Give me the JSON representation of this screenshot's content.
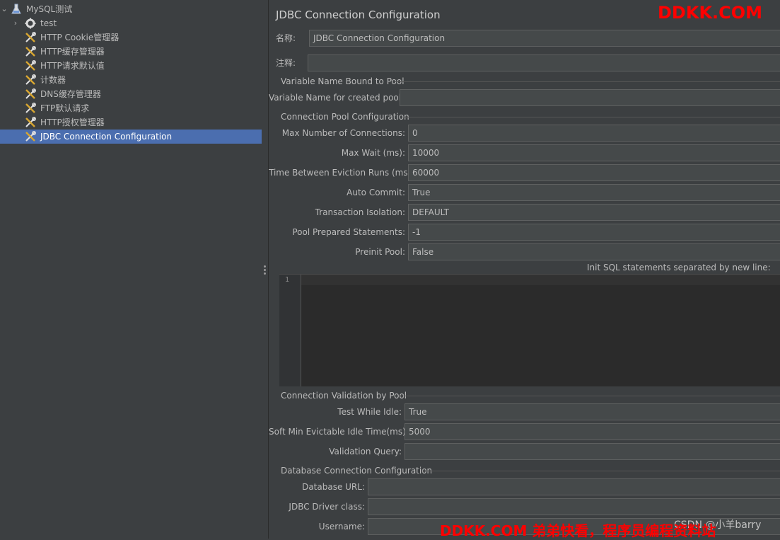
{
  "tree": {
    "root": {
      "label": "MySQL测试",
      "icon": "test-plan-flask-icon"
    },
    "items": [
      {
        "label": "test",
        "icon": "thread-group-gear-icon"
      },
      {
        "label": "HTTP Cookie管理器",
        "icon": "config-element-tools-icon"
      },
      {
        "label": "HTTP缓存管理器",
        "icon": "config-element-tools-icon"
      },
      {
        "label": "HTTP请求默认值",
        "icon": "config-element-tools-icon"
      },
      {
        "label": "计数器",
        "icon": "config-element-tools-icon"
      },
      {
        "label": "DNS缓存管理器",
        "icon": "config-element-tools-icon"
      },
      {
        "label": "FTP默认请求",
        "icon": "config-element-tools-icon"
      },
      {
        "label": "HTTP授权管理器",
        "icon": "config-element-tools-icon"
      },
      {
        "label": "JDBC Connection Configuration",
        "icon": "config-element-tools-icon",
        "selected": true
      }
    ]
  },
  "panel": {
    "title": "JDBC Connection Configuration",
    "name_label": "名称:",
    "name_value": "JDBC Connection Configuration",
    "comment_label": "注释:",
    "comment_value": "",
    "sections": {
      "variable": {
        "title": "Variable Name Bound to Pool",
        "var_name_label": "Variable Name for created pool:",
        "var_name_value": ""
      },
      "pool": {
        "title": "Connection Pool Configuration",
        "max_conn_label": "Max Number of Connections:",
        "max_conn_value": "0",
        "max_wait_label": "Max Wait (ms):",
        "max_wait_value": "10000",
        "eviction_label": "Time Between Eviction Runs (ms):",
        "eviction_value": "60000",
        "auto_commit_label": "Auto Commit:",
        "auto_commit_value": "True",
        "isolation_label": "Transaction Isolation:",
        "isolation_value": "DEFAULT",
        "prepared_label": "Pool Prepared Statements:",
        "prepared_value": "-1",
        "preinit_label": "Preinit Pool:",
        "preinit_value": "False",
        "init_sql_label": "Init SQL statements separated by new line:",
        "editor_line_number": "1"
      },
      "validation": {
        "title": "Connection Validation by Pool",
        "test_idle_label": "Test While Idle:",
        "test_idle_value": "True",
        "soft_min_label": "Soft Min Evictable Idle Time(ms):",
        "soft_min_value": "5000",
        "query_label": "Validation Query:",
        "query_value": ""
      },
      "database": {
        "title": "Database Connection Configuration",
        "url_label": "Database URL:",
        "url_value": "",
        "driver_label": "JDBC Driver class:",
        "driver_value": "",
        "username_label": "Username:",
        "username_value": ""
      }
    }
  },
  "watermarks": {
    "top": "DDKK.COM",
    "bottom": "DDKK.COM 弟弟快看，程序员编程资料站",
    "csdn": "CSDN @小羊barry"
  },
  "colors": {
    "background": "#3c3f41",
    "selection": "#4b6eaf",
    "field": "#45494a",
    "editor": "#2b2b2b",
    "watermark": "#ff0000"
  }
}
